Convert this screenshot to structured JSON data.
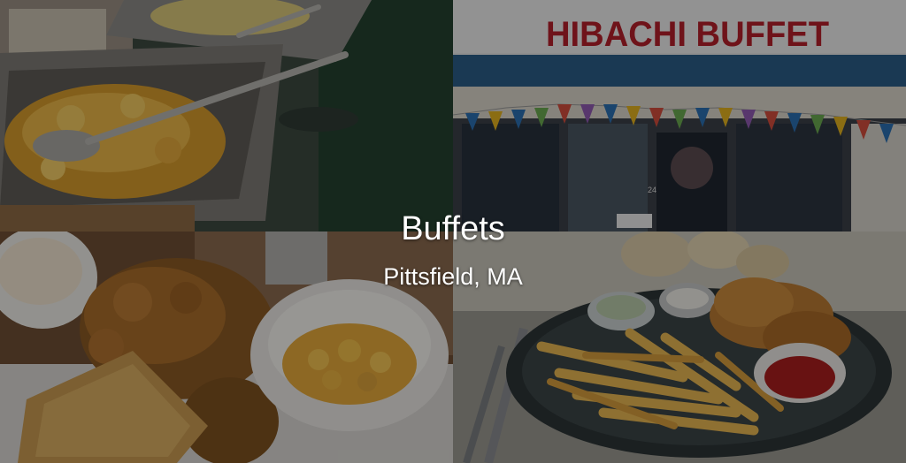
{
  "overlay": {
    "title": "Buffets",
    "subtitle": "Pittsfield, MA"
  },
  "photos": {
    "top_left": {
      "subject": "buffet steam trays with serving spoons"
    },
    "top_right": {
      "subject": "restaurant storefront with pennant banners",
      "sign_text": "HIBACHI BUFFET",
      "door_number": "24"
    },
    "bottom_left": {
      "subject": "fried chicken, cornbread and mac and cheese"
    },
    "bottom_right": {
      "subject": "fish and chips with dipping sauces"
    }
  },
  "colors": {
    "sign_red": "#b3202a",
    "awning_blue": "#2b5d86",
    "overlay": "rgba(0,0,0,0.38)",
    "text": "#ffffff"
  }
}
